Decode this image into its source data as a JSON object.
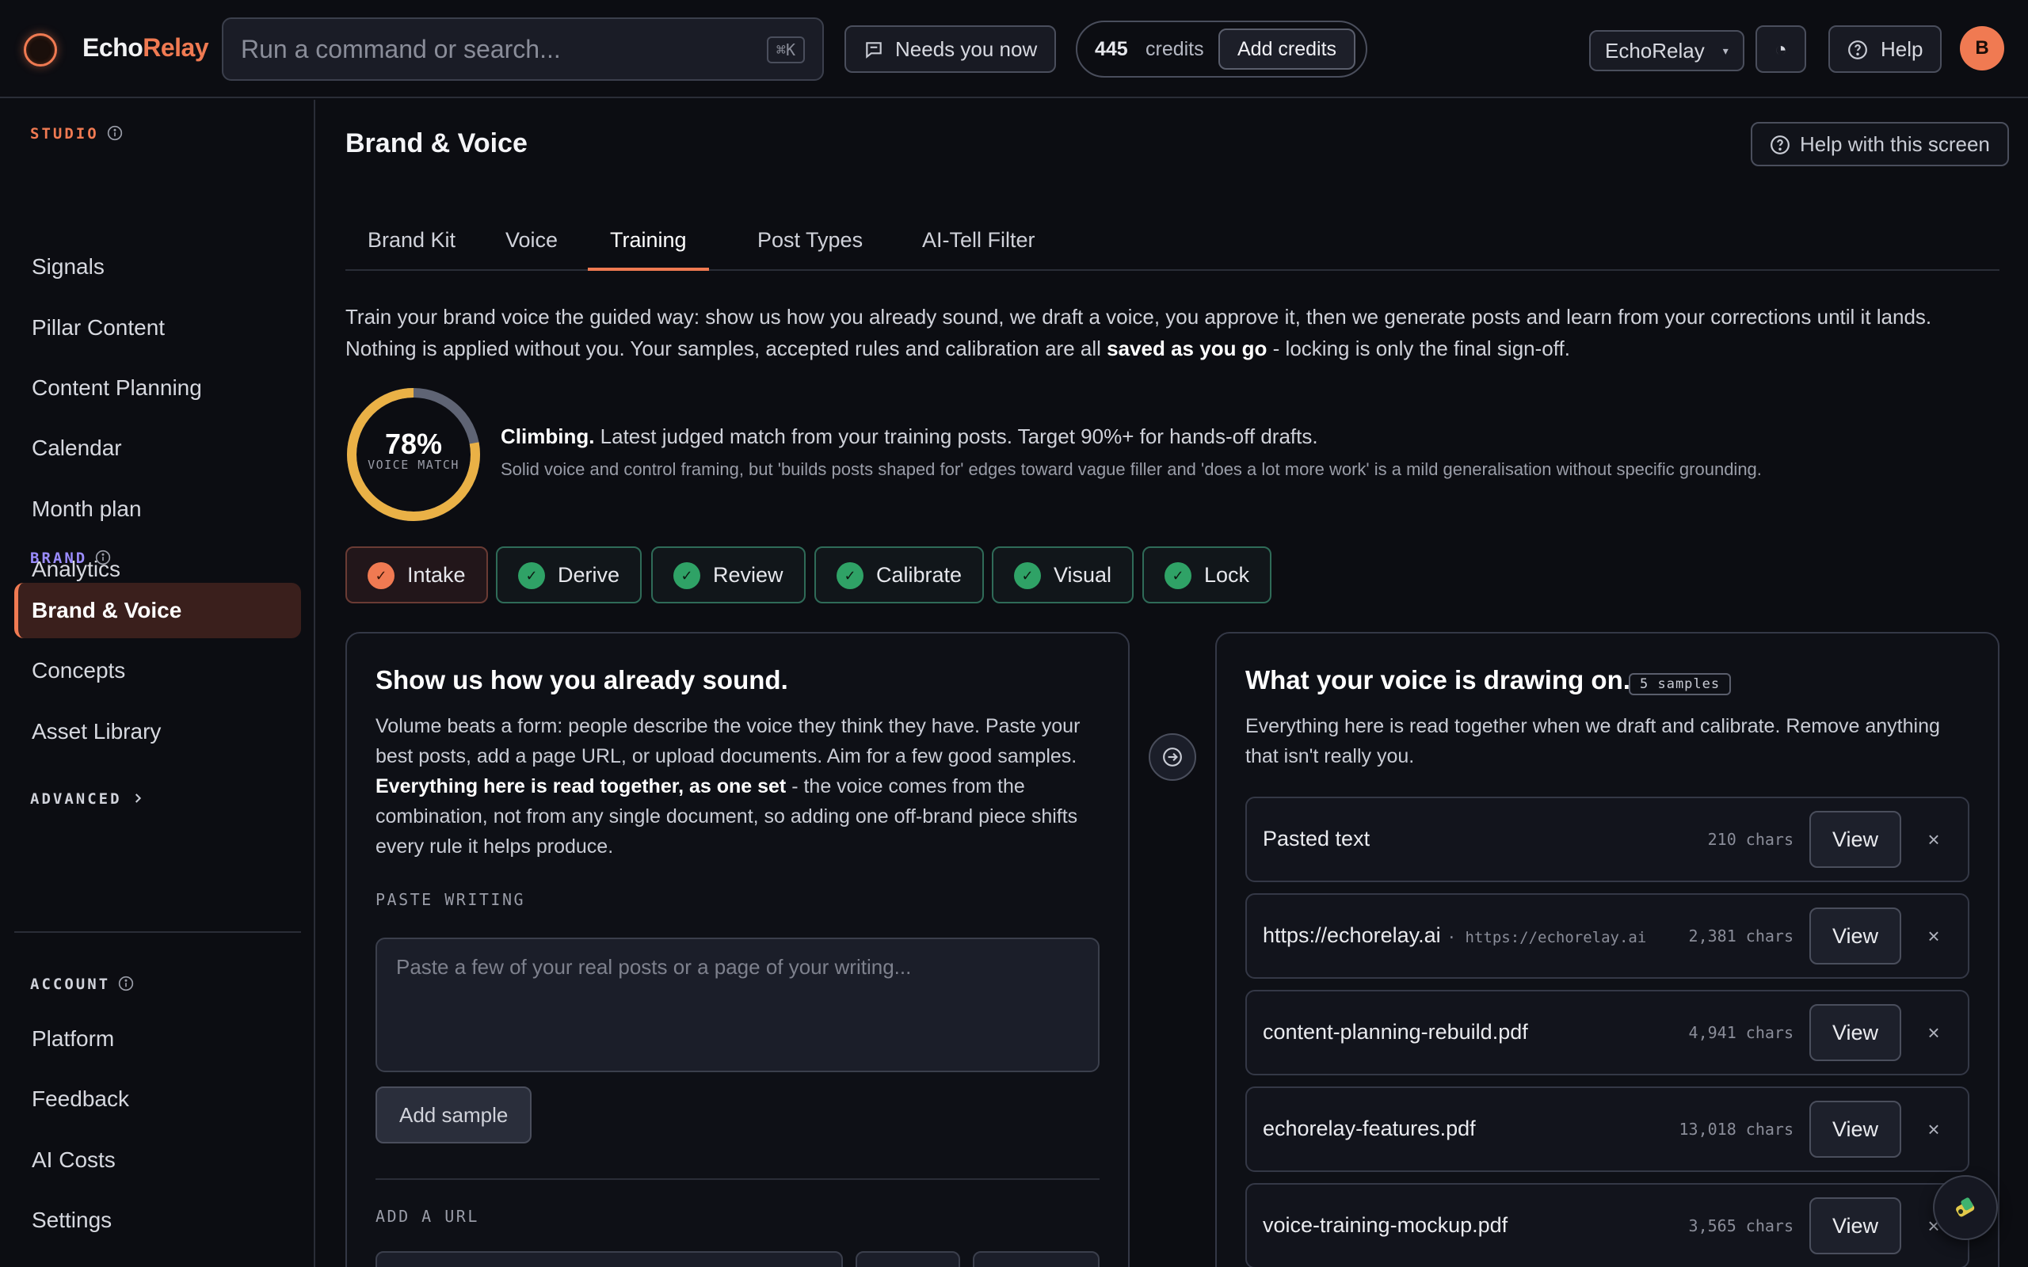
{
  "app": {
    "logo_part1": "Echo",
    "logo_part2": "Relay",
    "workspace": "EchoRelay",
    "avatar_initial": "B",
    "accent_color": "#f07a52",
    "success_color": "#2fa266"
  },
  "topbar": {
    "search_placeholder": "Run a command or search...",
    "search_shortcut": "⌘K",
    "needs_label": "Needs you now",
    "credits_value": "445",
    "credits_label": "credits",
    "add_credits_label": "Add credits",
    "timer_glyph": "◔",
    "help_label": "Help"
  },
  "sidebar": {
    "studio_label": "STUDIO",
    "studio_items": [
      "Signals",
      "Pillar Content",
      "Content Planning",
      "Calendar",
      "Month plan",
      "Analytics"
    ],
    "brand_label": "BRAND",
    "brand_items": [
      "Brand & Voice",
      "Concepts",
      "Asset Library"
    ],
    "advanced_label": "ADVANCED",
    "account_label": "ACCOUNT",
    "account_items": [
      "Platform",
      "Feedback",
      "AI Costs",
      "Settings"
    ]
  },
  "page": {
    "title": "Brand & Voice",
    "screen_help": "Help with this screen",
    "tabs": [
      "Brand Kit",
      "Voice",
      "Training",
      "Post Types",
      "AI-Tell Filter"
    ],
    "active_tab": "Training",
    "intro_part1": "Train your brand voice the guided way: show us how you already sound, we draft a voice, you approve it, then we generate posts and learn from your corrections until it lands. Nothing is applied without you. Your samples, accepted rules and calibration are all ",
    "intro_bold": "saved as you go",
    "intro_part2": " - locking is only the final sign-off."
  },
  "voice_match": {
    "value_text": "78%",
    "value": 0.78,
    "label": "VOICE MATCH",
    "headline_bold": "Climbing.",
    "headline_rest": " Latest judged match from your training posts. Target 90%+ for hands-off drafts.",
    "detail": "Solid voice and control framing, but 'builds posts shaped for' edges toward vague filler and 'does a lot more work' is a mild generalisation without specific grounding."
  },
  "steps": [
    {
      "label": "Intake",
      "current": true
    },
    {
      "label": "Derive",
      "current": false
    },
    {
      "label": "Review",
      "current": false
    },
    {
      "label": "Calibrate",
      "current": false
    },
    {
      "label": "Visual",
      "current": false
    },
    {
      "label": "Lock",
      "current": false
    }
  ],
  "intake": {
    "title": "Show us how you already sound.",
    "desc_part1": "Volume beats a form: people describe the voice they think they have. Paste your best posts, add a page URL, or upload documents. Aim for a few good samples. ",
    "desc_bold": "Everything here is read together, as one set",
    "desc_part2": " - the voice comes from the combination, not from any single document, so adding one off-brand piece shifts every rule it helps produce.",
    "paste_label": "PASTE WRITING",
    "paste_placeholder": "Paste a few of your real posts or a page of your writing...",
    "add_sample_label": "Add sample",
    "url_label": "ADD A URL"
  },
  "drawing": {
    "title": "What your voice is drawing on.",
    "badge": "5 samples",
    "desc": "Everything here is read together when we draft and calibrate. Remove anything that isn't really you.",
    "view_label": "View",
    "remove_glyph": "×",
    "samples": [
      {
        "name": "Pasted text",
        "url": "",
        "chars": "210 chars"
      },
      {
        "name": "https://echorelay.ai",
        "url": "· https://echorelay.ai",
        "chars": "2,381 chars"
      },
      {
        "name": "content-planning-rebuild.pdf",
        "url": "",
        "chars": "4,941 chars"
      },
      {
        "name": "echorelay-features.pdf",
        "url": "",
        "chars": "13,018 chars"
      },
      {
        "name": "voice-training-mockup.pdf",
        "url": "",
        "chars": "3,565 chars"
      }
    ]
  }
}
